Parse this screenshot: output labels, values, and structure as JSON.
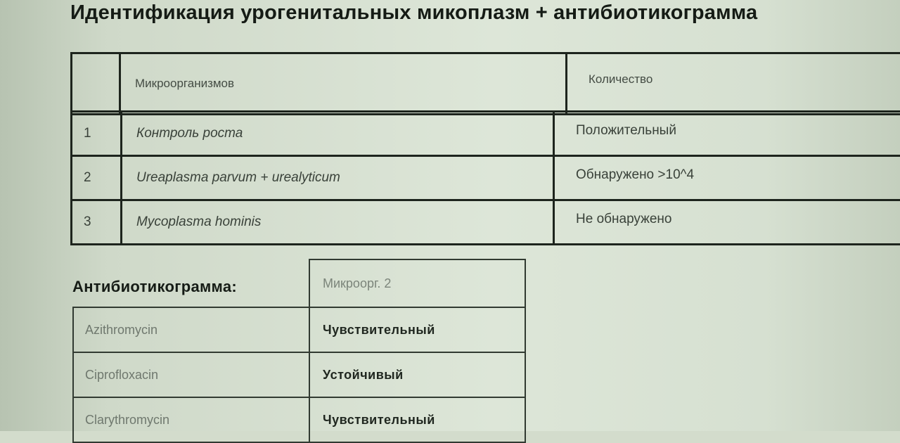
{
  "title": "Идентификация урогенитальных микоплазм + антибиотикограмма",
  "results_table": {
    "headers": {
      "number": "",
      "organism": "Микроорганизмов",
      "quantity": "Количество"
    },
    "rows": [
      {
        "number": "1",
        "organism": "Контроль роста",
        "quantity": "Положительный"
      },
      {
        "number": "2",
        "organism": "Ureaplasma parvum + urealyticum",
        "quantity": "Обнаружено >10^4"
      },
      {
        "number": "3",
        "organism": "Mycoplasma hominis",
        "quantity": "Не обнаружено"
      }
    ]
  },
  "antibiogram": {
    "label": "Антибиотикограмма:",
    "column_header": "Микроорг. 2",
    "rows": [
      {
        "drug": "Azithromycin",
        "result": "Чувствительный"
      },
      {
        "drug": "Ciprofloxacin",
        "result": "Устойчивый"
      },
      {
        "drug": "Clarythromycin",
        "result": "Чувствительный"
      }
    ]
  }
}
